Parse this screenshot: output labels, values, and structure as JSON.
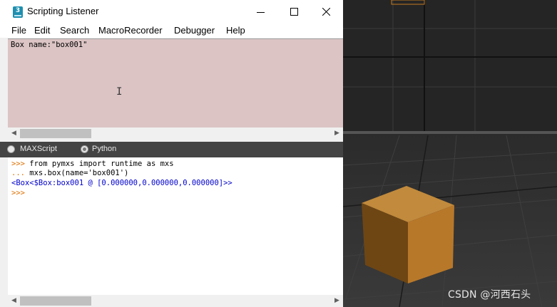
{
  "window": {
    "title": "Scripting Listener",
    "icon_label": "3"
  },
  "menu": [
    "File",
    "Edit",
    "Search",
    "MacroRecorder",
    "Debugger",
    "Help"
  ],
  "macro_recorder": {
    "text": "Box name:\"box001\""
  },
  "language_tabs": {
    "options": [
      "MAXScript",
      "Python"
    ],
    "selected": "Python"
  },
  "listener_output": {
    "lines": [
      {
        "prompt": ">>>",
        "text": " from pymxs import runtime as mxs"
      },
      {
        "prompt": "...",
        "text": " mxs.box(name='box001')"
      },
      {
        "prompt": "",
        "text": "<Box<$Box:box001 @ [0.000000,0.000000,0.000000]>>"
      },
      {
        "prompt": ">>>",
        "text": ""
      }
    ]
  },
  "viewport": {
    "box_color": "#b87b2e",
    "watermark": "CSDN @河西石头"
  },
  "colors": {
    "macro_pane_bg": "#dcc4c4",
    "prompt": "#e07000",
    "result": "#0000cc"
  }
}
